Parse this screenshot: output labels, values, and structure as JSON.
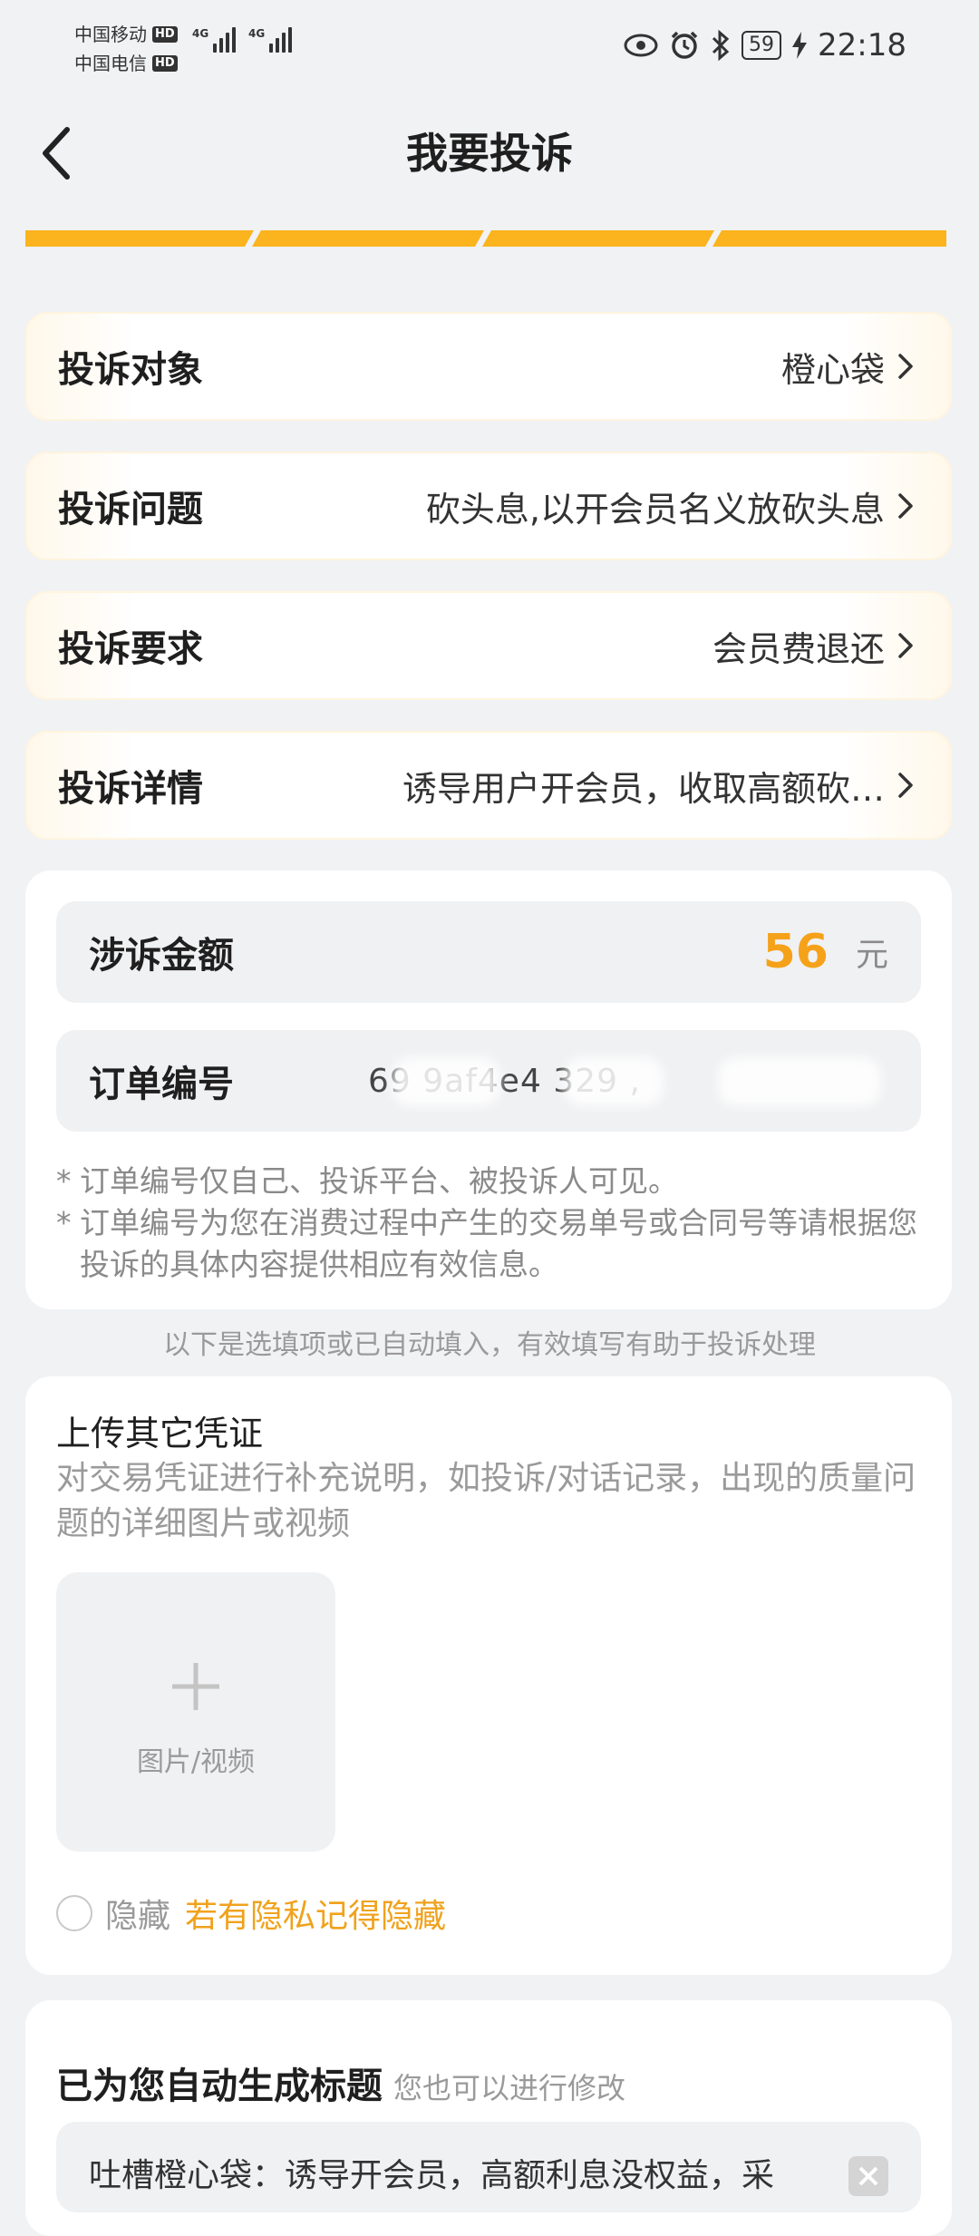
{
  "status_bar": {
    "carrier1": "中国移动",
    "carrier2": "中国电信",
    "hd": "HD",
    "net_tag": "4G",
    "battery": "59",
    "time": "22:18"
  },
  "header": {
    "title": "我要投诉",
    "back_icon": "chevron-left-icon"
  },
  "progress": {
    "steps": 4,
    "color": "#fbb31e"
  },
  "complaint": {
    "target_label": "投诉对象",
    "target_value": "橙心袋",
    "issue_label": "投诉问题",
    "issue_value": "砍头息,以开会员名义放砍头息",
    "demand_label": "投诉要求",
    "demand_value": "会员费退还",
    "detail_label": "投诉详情",
    "detail_value": "诱导用户开会员，收取高额砍…"
  },
  "amount": {
    "label": "涉诉金额",
    "value": "56",
    "unit": "元",
    "accent_color": "#f5a21a"
  },
  "order": {
    "label": "订单编号",
    "value": "69  9af4e4   329       ,"
  },
  "notes": {
    "star": "*",
    "note1": "订单编号仅自己、投诉平台、被投诉人可见。",
    "note2": "订单编号为您在消费过程中产生的交易单号或合同号等请根据您投诉的具体内容提供相应有效信息。"
  },
  "hint": "以下是选填项或已自动填入，有效填写有助于投诉处理",
  "upload": {
    "title": "上传其它凭证",
    "description": "对交易凭证进行补充说明，如投诉/对话记录，出现的质量问题的详细图片或视频",
    "button_label": "图片/视频",
    "hide_label": "隐藏",
    "hide_tip": "若有隐私记得隐藏"
  },
  "auto_title": {
    "main": "已为您自动生成标题",
    "sub": "您也可以进行修改",
    "value": "吐槽橙心袋：诱导开会员，高额利息没权益，采"
  }
}
